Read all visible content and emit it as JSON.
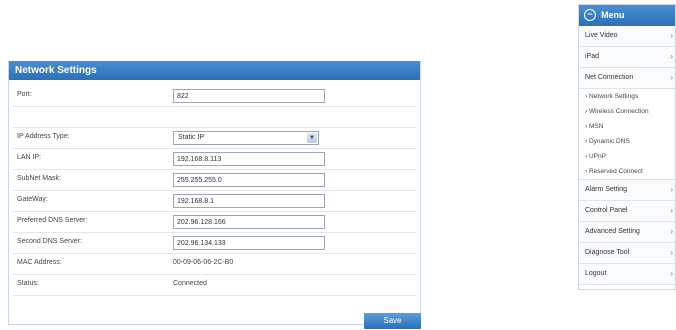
{
  "panel": {
    "title": "Network Settings",
    "port_label": "Port:",
    "port_value": "822",
    "ip_type_label": "IP Address Type:",
    "ip_type_value": "Static IP",
    "lan_ip_label": "LAN IP:",
    "lan_ip_value": "192.168.8.113",
    "subnet_label": "SubNet Mask:",
    "subnet_value": "255.255.255.0",
    "gateway_label": "GateWay:",
    "gateway_value": "192.168.8.1",
    "dns1_label": "Preferred DNS Server:",
    "dns1_value": "202.96.128.166",
    "dns2_label": "Second DNS Server:",
    "dns2_value": "202.96.134.133",
    "mac_label": "MAC Address:",
    "mac_value": "00-09-06-06-2C-B0",
    "status_label": "Status:",
    "status_value": "Connected",
    "save_label": "Save"
  },
  "menu": {
    "title": "Menu",
    "items": [
      {
        "label": "Live Video"
      },
      {
        "label": "iPad"
      },
      {
        "label": "Net Connection"
      }
    ],
    "subitems": [
      {
        "label": "› Network Settings"
      },
      {
        "label": "› Wireless Connection"
      },
      {
        "label": "› MSN"
      },
      {
        "label": "› Dynamic DNS"
      },
      {
        "label": "› UPnP"
      },
      {
        "label": "› Reserved Connect"
      }
    ],
    "items_after": [
      {
        "label": "Alarm Setting"
      },
      {
        "label": "Control Panel"
      },
      {
        "label": "Advanced Setting"
      },
      {
        "label": "Diagnose Tool"
      },
      {
        "label": "Logout"
      }
    ]
  }
}
